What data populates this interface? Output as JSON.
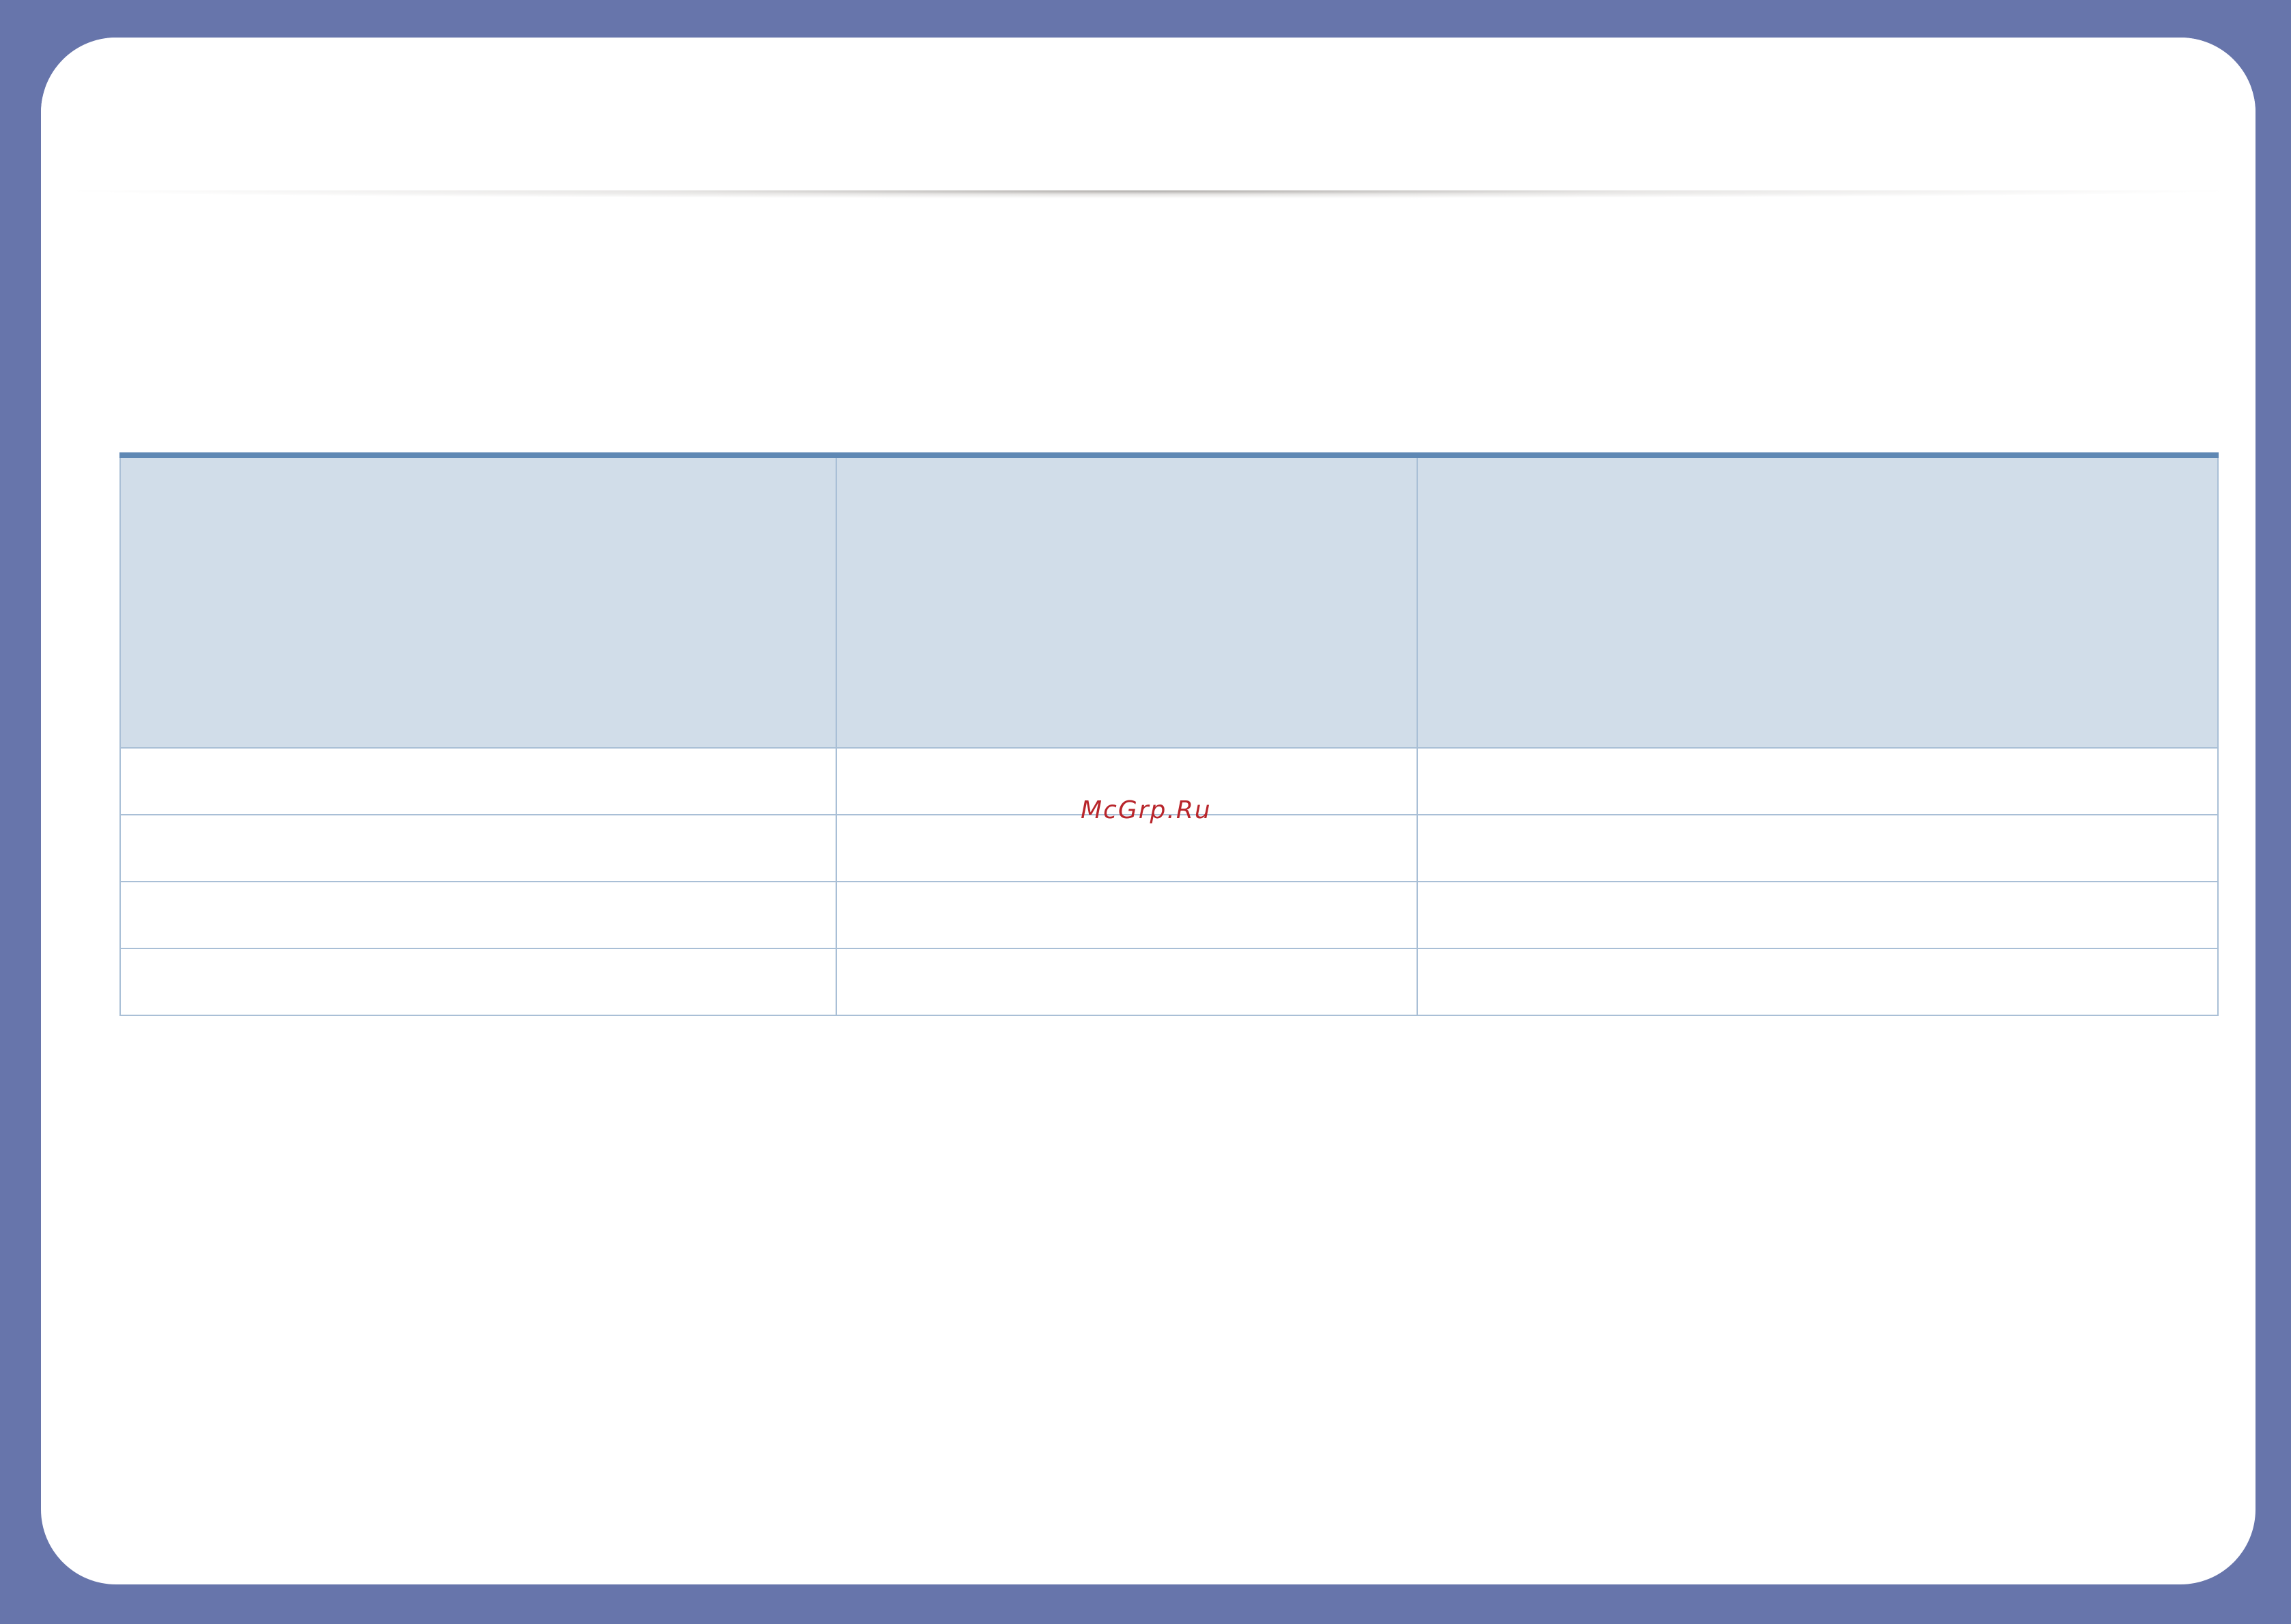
{
  "colors": {
    "frame": "#6775ab",
    "page": "#ffffff",
    "table_top_rule": "#5f88b4",
    "table_header_fill": "#d1dde9",
    "table_grid": "#a9bfd6",
    "watermark": "#b8252b"
  },
  "table": {
    "header": [
      "",
      "",
      ""
    ],
    "rows": [
      [
        "",
        "",
        ""
      ],
      [
        "",
        "",
        ""
      ],
      [
        "",
        "",
        ""
      ],
      [
        "",
        "",
        ""
      ]
    ]
  },
  "watermark": {
    "text": "McGrp.Ru"
  }
}
